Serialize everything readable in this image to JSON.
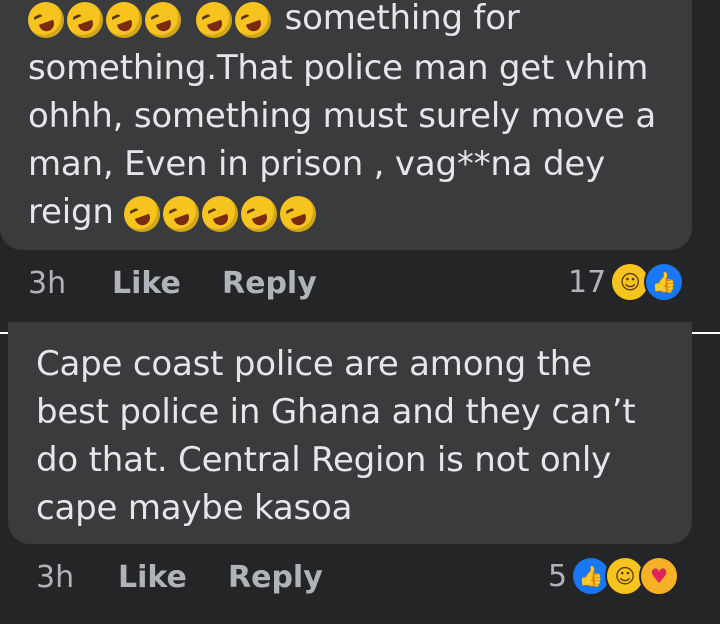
{
  "comment1": {
    "lines": [
      "something for",
      "something.That police man get vhim",
      "ohhh, something must surely move a",
      "man, Even in prison , vag**na dey",
      "reign"
    ],
    "time": "3h",
    "like_label": "Like",
    "reply_label": "Reply",
    "reaction_count": "17",
    "reactions": [
      "haha-icon",
      "like-icon"
    ]
  },
  "comment2": {
    "lines": [
      "Cape coast police are  among the",
      "best police in Ghana and they can’t",
      "do that. Central Region is not only",
      "cape maybe kasoa"
    ],
    "time": "3h",
    "like_label": "Like",
    "reply_label": "Reply",
    "reaction_count": "5",
    "reactions": [
      "like-icon",
      "haha-icon",
      "care-icon"
    ]
  }
}
